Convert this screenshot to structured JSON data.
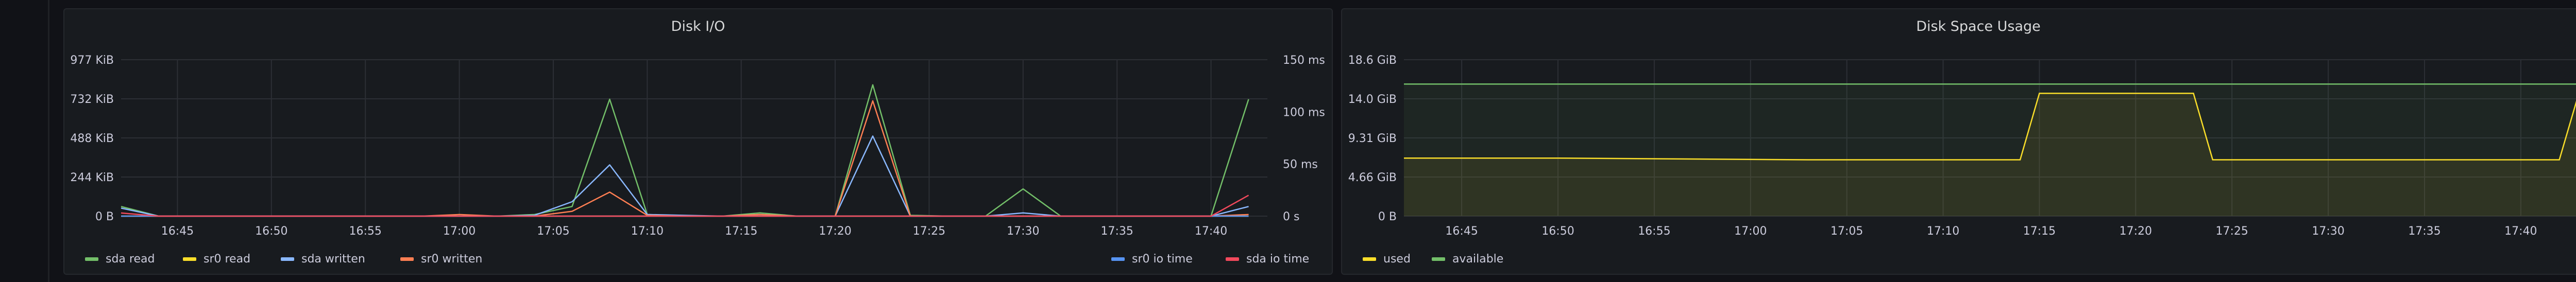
{
  "panels": {
    "disk_io": {
      "title": "Disk I/O"
    },
    "disk_space": {
      "title": "Disk Space Usage"
    }
  },
  "chart_data": [
    {
      "type": "line",
      "title": "Disk I/O",
      "x_ticks": [
        "16:45",
        "16:50",
        "16:55",
        "17:00",
        "17:05",
        "17:10",
        "17:15",
        "17:20",
        "17:25",
        "17:30",
        "17:35",
        "17:40"
      ],
      "y_left_ticks": [
        "0 B",
        "244 KiB",
        "488 KiB",
        "732 KiB",
        "977 KiB"
      ],
      "y_right_ticks": [
        "0 s",
        "50 ms",
        "100 ms",
        "150 ms"
      ],
      "ylim_left_kib": [
        0,
        977
      ],
      "ylim_right_ms": [
        0,
        150
      ],
      "x_range": [
        "16:42",
        "17:43"
      ],
      "x_minutes": [
        0,
        2,
        4,
        6,
        8,
        10,
        12,
        14,
        16,
        18,
        20,
        22,
        24,
        26,
        28,
        30,
        32,
        34,
        36,
        38,
        40,
        42,
        44,
        46,
        48,
        50,
        52,
        54,
        56,
        58,
        60
      ],
      "series": [
        {
          "name": "sda read",
          "color": "#73bf69",
          "axis": "left",
          "values": [
            60,
            0,
            0,
            0,
            0,
            0,
            0,
            0,
            0,
            0,
            0,
            10,
            60,
            730,
            10,
            0,
            0,
            20,
            0,
            0,
            820,
            5,
            0,
            0,
            170,
            0,
            0,
            0,
            0,
            0,
            730
          ]
        },
        {
          "name": "sr0 read",
          "color": "#fade2a",
          "axis": "left",
          "values": [
            0,
            0,
            0,
            0,
            0,
            0,
            0,
            0,
            0,
            0,
            0,
            0,
            0,
            0,
            0,
            0,
            0,
            0,
            0,
            0,
            0,
            0,
            0,
            0,
            0,
            0,
            0,
            0,
            0,
            0,
            0
          ]
        },
        {
          "name": "sda written",
          "color": "#8ab8ff",
          "axis": "left",
          "values": [
            50,
            0,
            0,
            0,
            0,
            0,
            0,
            0,
            0,
            0,
            0,
            5,
            90,
            320,
            10,
            5,
            0,
            10,
            0,
            0,
            500,
            0,
            0,
            0,
            20,
            0,
            0,
            0,
            0,
            0,
            60
          ]
        },
        {
          "name": "sr0 written",
          "color": "#ff7f53",
          "axis": "left",
          "values": [
            0,
            0,
            0,
            0,
            0,
            0,
            0,
            0,
            0,
            10,
            0,
            0,
            30,
            150,
            5,
            0,
            0,
            10,
            0,
            0,
            720,
            0,
            0,
            0,
            0,
            0,
            0,
            0,
            0,
            0,
            10
          ]
        },
        {
          "name": "sr0 io time",
          "color": "#5794f2",
          "axis": "right",
          "values": [
            0,
            0,
            0,
            0,
            0,
            0,
            0,
            0,
            0,
            0,
            0,
            0,
            0,
            0,
            0,
            0,
            0,
            0,
            0,
            0,
            0,
            0,
            0,
            0,
            0,
            0,
            0,
            0,
            0,
            0,
            0
          ]
        },
        {
          "name": "sda io time",
          "color": "#f2495c",
          "axis": "right",
          "values": [
            3,
            0,
            0,
            0,
            0,
            0,
            0,
            0,
            0,
            0,
            0,
            0,
            0,
            0,
            0,
            0,
            0,
            0,
            0,
            0,
            0,
            0,
            0,
            0,
            0,
            0,
            0,
            0,
            0,
            0,
            20
          ]
        }
      ],
      "legend_left": [
        "sda read",
        "sr0 read",
        "sda written",
        "sr0 written"
      ],
      "legend_right": [
        "sr0 io time",
        "sda io time"
      ]
    },
    {
      "type": "area",
      "title": "Disk Space Usage",
      "x_ticks": [
        "16:45",
        "16:50",
        "16:55",
        "17:00",
        "17:05",
        "17:10",
        "17:15",
        "17:20",
        "17:25",
        "17:30",
        "17:35",
        "17:40"
      ],
      "y_ticks": [
        "0 B",
        "4.66 GiB",
        "9.31 GiB",
        "14.0 GiB",
        "18.6 GiB"
      ],
      "ylim_gib": [
        0,
        18.6
      ],
      "x_range": [
        "16:42",
        "17:43"
      ],
      "series": [
        {
          "name": "used",
          "color": "#fade2a",
          "points": [
            [
              0,
              6.9
            ],
            [
              8,
              6.9
            ],
            [
              21,
              6.7
            ],
            [
              32,
              6.7
            ],
            [
              33,
              14.6
            ],
            [
              41,
              14.6
            ],
            [
              42,
              6.7
            ],
            [
              60,
              6.7
            ],
            [
              61,
              14.5
            ]
          ]
        },
        {
          "name": "available",
          "color": "#73bf69",
          "points": [
            [
              0,
              15.7
            ],
            [
              61,
              15.7
            ]
          ]
        }
      ],
      "legend": [
        "used",
        "available"
      ]
    }
  ]
}
